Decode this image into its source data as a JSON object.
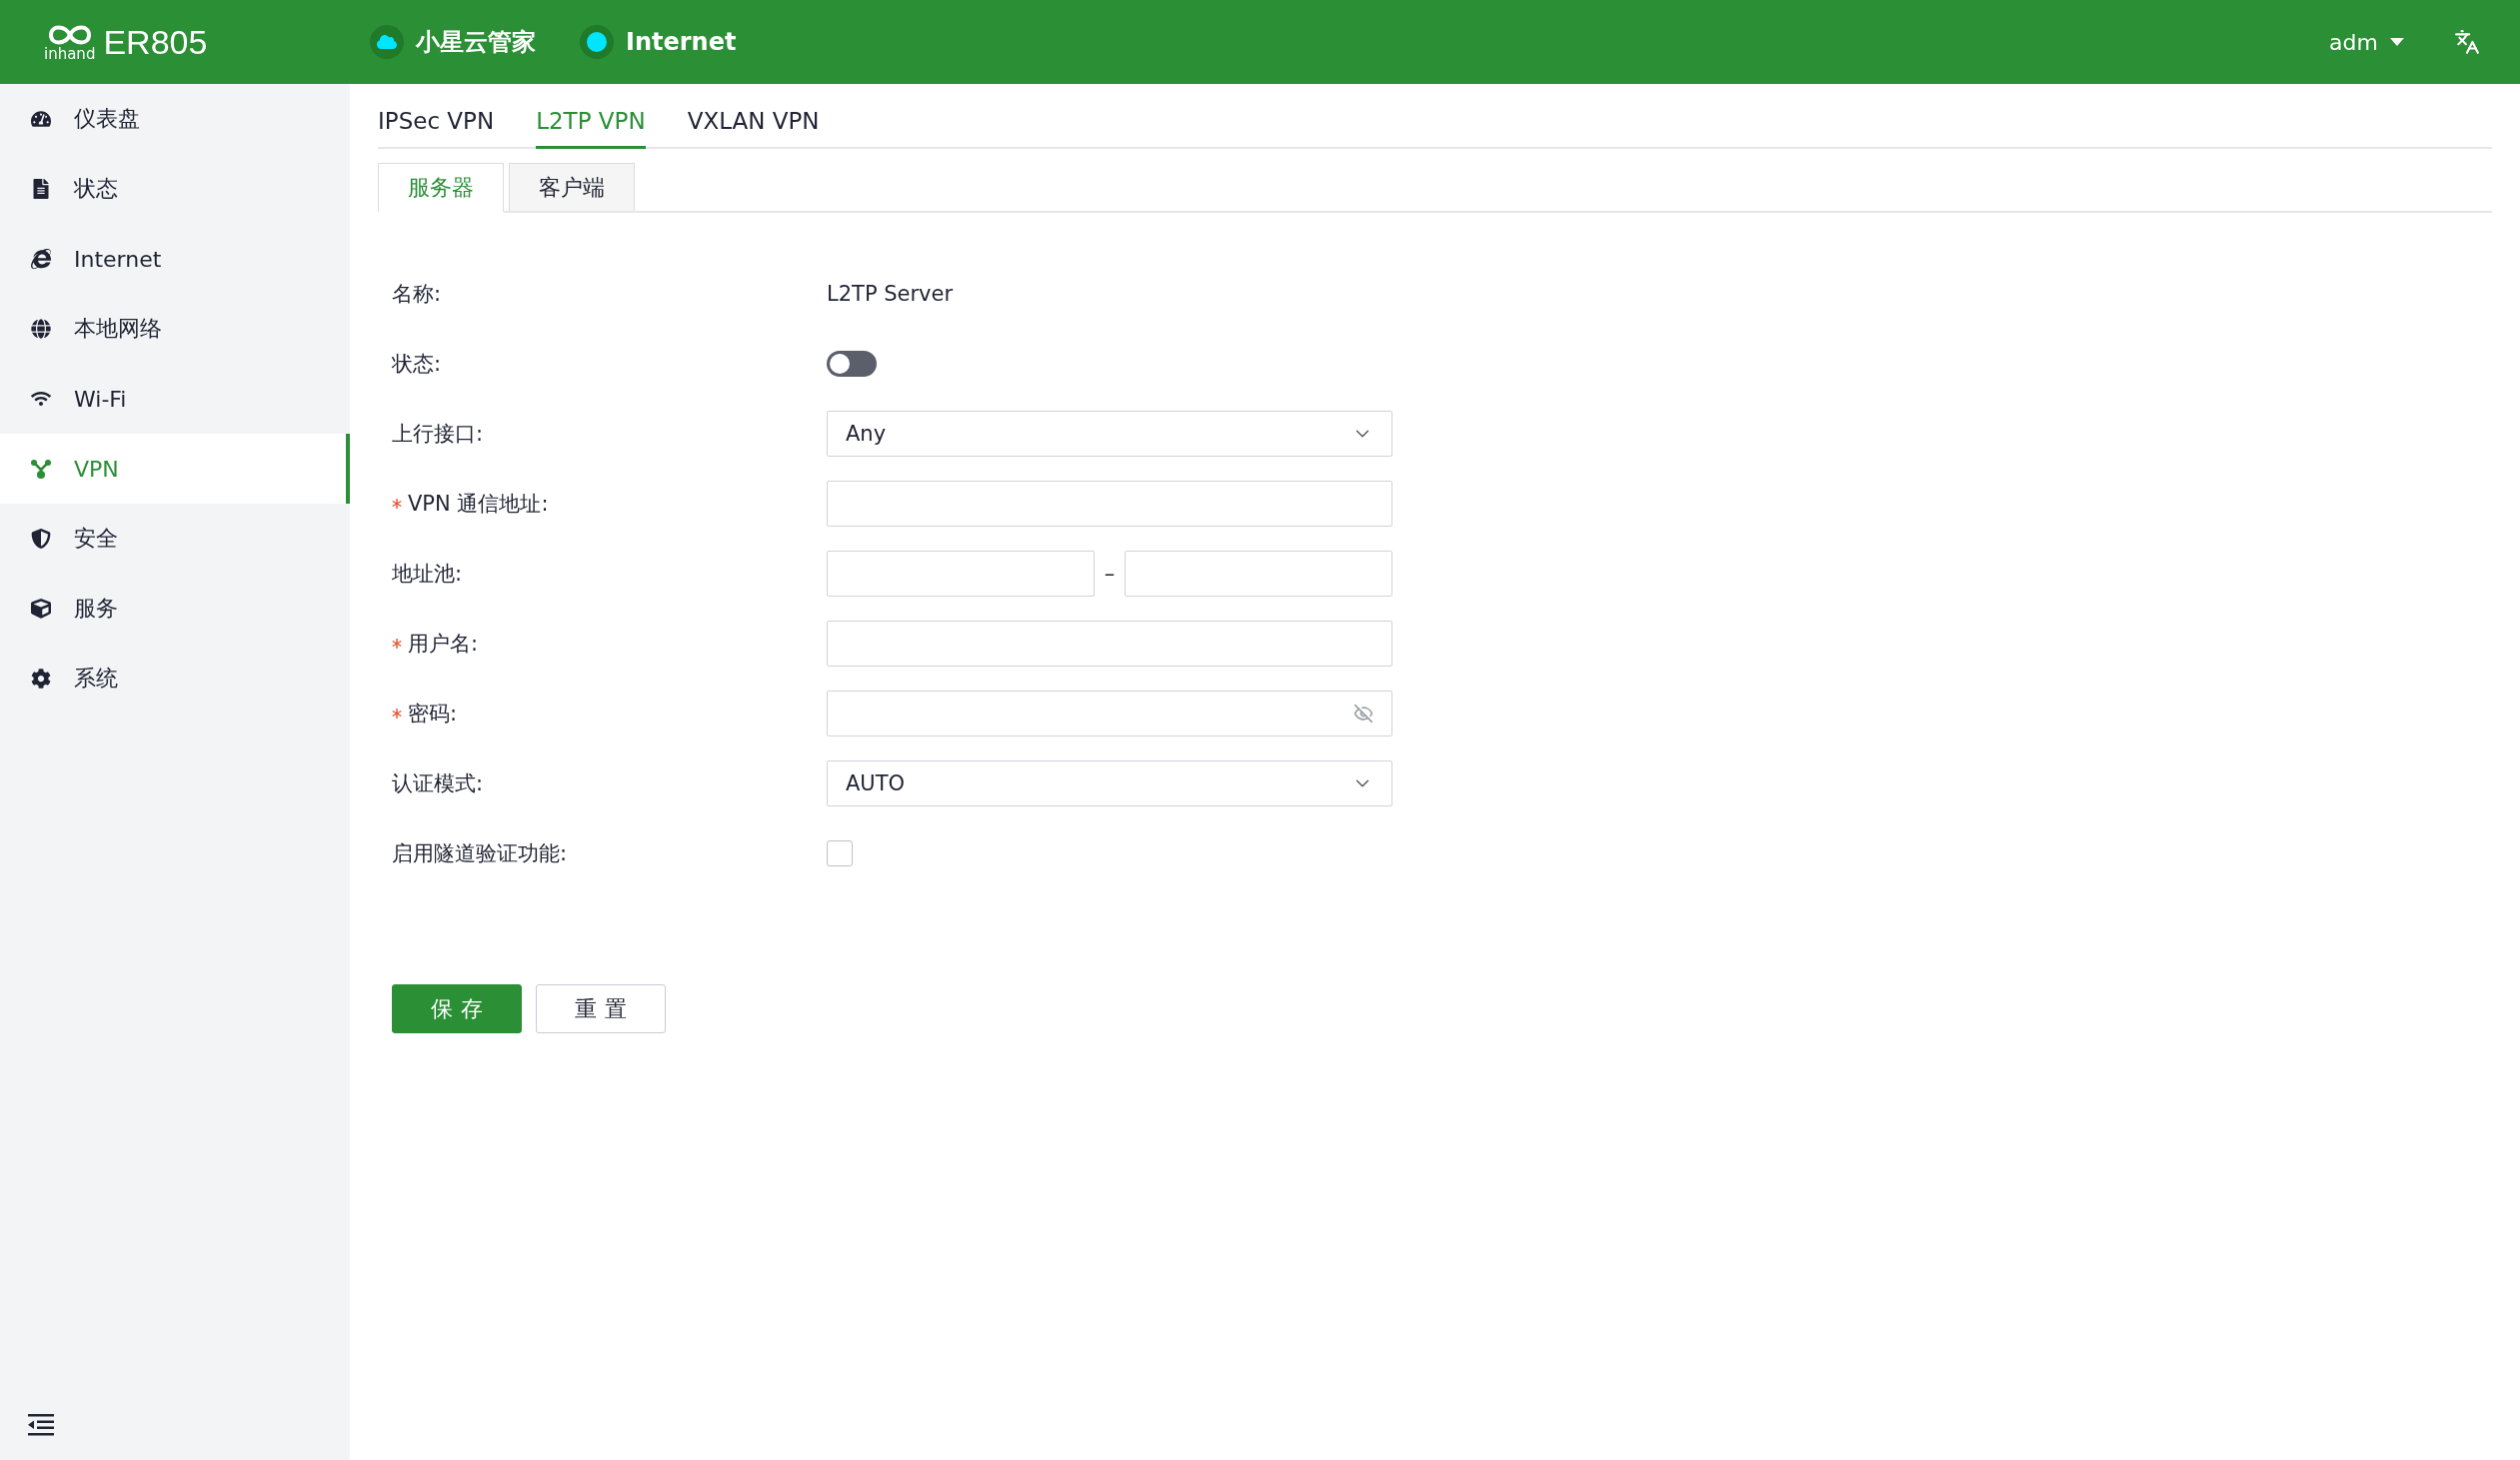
{
  "header": {
    "brand": "inhand",
    "model": "ER805",
    "status": [
      {
        "kind": "cloud",
        "label": "小星云管家"
      },
      {
        "kind": "dot",
        "label": "Internet"
      }
    ],
    "user": "adm"
  },
  "sidebar": {
    "items": [
      {
        "label": "仪表盘",
        "selected": false
      },
      {
        "label": "状态",
        "selected": false
      },
      {
        "label": "Internet",
        "selected": false
      },
      {
        "label": "本地网络",
        "selected": false
      },
      {
        "label": "Wi-Fi",
        "selected": false
      },
      {
        "label": "VPN",
        "selected": true
      },
      {
        "label": "安全",
        "selected": false
      },
      {
        "label": "服务",
        "selected": false
      },
      {
        "label": "系统",
        "selected": false
      }
    ]
  },
  "tabs": [
    {
      "label": "IPSec VPN",
      "selected": false
    },
    {
      "label": "L2TP VPN",
      "selected": true
    },
    {
      "label": "VXLAN VPN",
      "selected": false
    }
  ],
  "subtabs": [
    {
      "label": "服务器",
      "selected": true
    },
    {
      "label": "客户端",
      "selected": false
    }
  ],
  "form": [
    {
      "kind": "text",
      "label": "名称:",
      "required": false,
      "value": "L2TP Server"
    },
    {
      "kind": "switch",
      "label": "状态:",
      "required": false,
      "on": false
    },
    {
      "kind": "select",
      "label": "上行接口:",
      "required": false,
      "value": "Any"
    },
    {
      "kind": "input",
      "label": "VPN 通信地址:",
      "required": true
    },
    {
      "kind": "range",
      "label": "地址池:",
      "required": false,
      "separator": "–"
    },
    {
      "kind": "input",
      "label": "用户名:",
      "required": true
    },
    {
      "kind": "password",
      "label": "密码:",
      "required": true
    },
    {
      "kind": "select",
      "label": "认证模式:",
      "required": false,
      "value": "AUTO"
    },
    {
      "kind": "checkbox",
      "label": "启用隧道验证功能:",
      "required": false,
      "checked": false
    }
  ],
  "buttons": [
    {
      "kind": "primary",
      "label": "保存"
    },
    {
      "kind": "default",
      "label": "重置"
    }
  ]
}
